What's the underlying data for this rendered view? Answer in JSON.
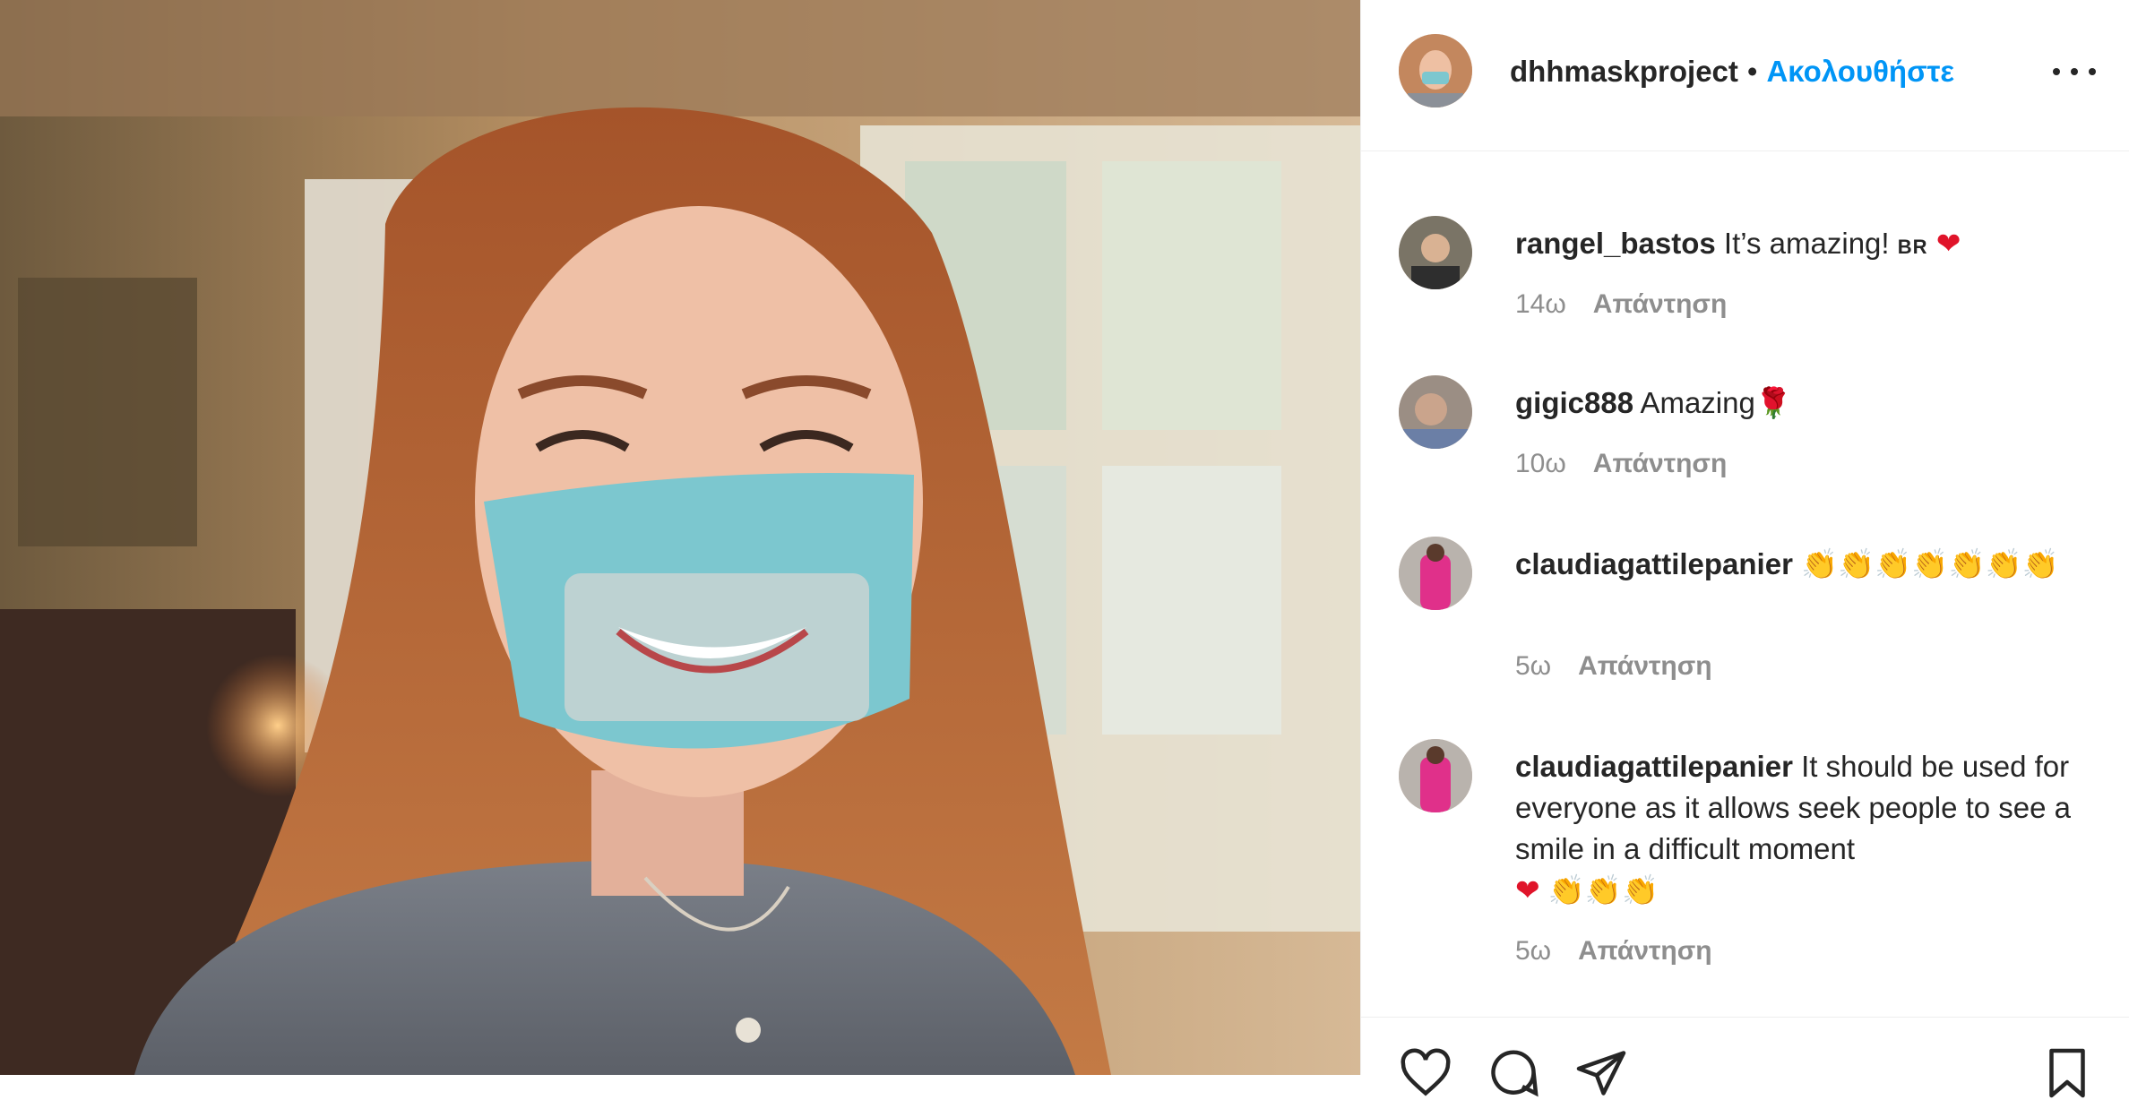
{
  "post": {
    "username": "dhhmaskproject",
    "separator": "•",
    "follow_label": "Ακολουθήστε",
    "more_icon": "more-options-icon"
  },
  "comments": [
    {
      "username": "rangel_bastos",
      "text": "It’s amazing!",
      "badge": "BR",
      "emoji": "❤",
      "time": "14ω",
      "reply_label": "Απάντηση"
    },
    {
      "username": "gigic888",
      "text": "Amazing",
      "emoji": "🌹",
      "time": "10ω",
      "reply_label": "Απάντηση"
    },
    {
      "username": "claudiagattilepanier",
      "text": "",
      "emoji": "👏👏👏👏👏👏👏",
      "time": "5ω",
      "reply_label": "Απάντηση"
    },
    {
      "username": "claudiagattilepanier",
      "text": "It should be used for everyone as it allows seek people to see a smile in a difficult moment",
      "emoji_heart": "❤",
      "emoji": "👏👏👏",
      "time": "5ω",
      "reply_label": "Απάντηση"
    }
  ],
  "actions": {
    "like_icon": "heart-icon",
    "comment_icon": "comment-icon",
    "share_icon": "share-icon",
    "save_icon": "bookmark-icon"
  },
  "colors": {
    "accent": "#0095f6",
    "text": "#262626",
    "muted": "#8e8e8e",
    "mask": "#7cc7cf"
  }
}
